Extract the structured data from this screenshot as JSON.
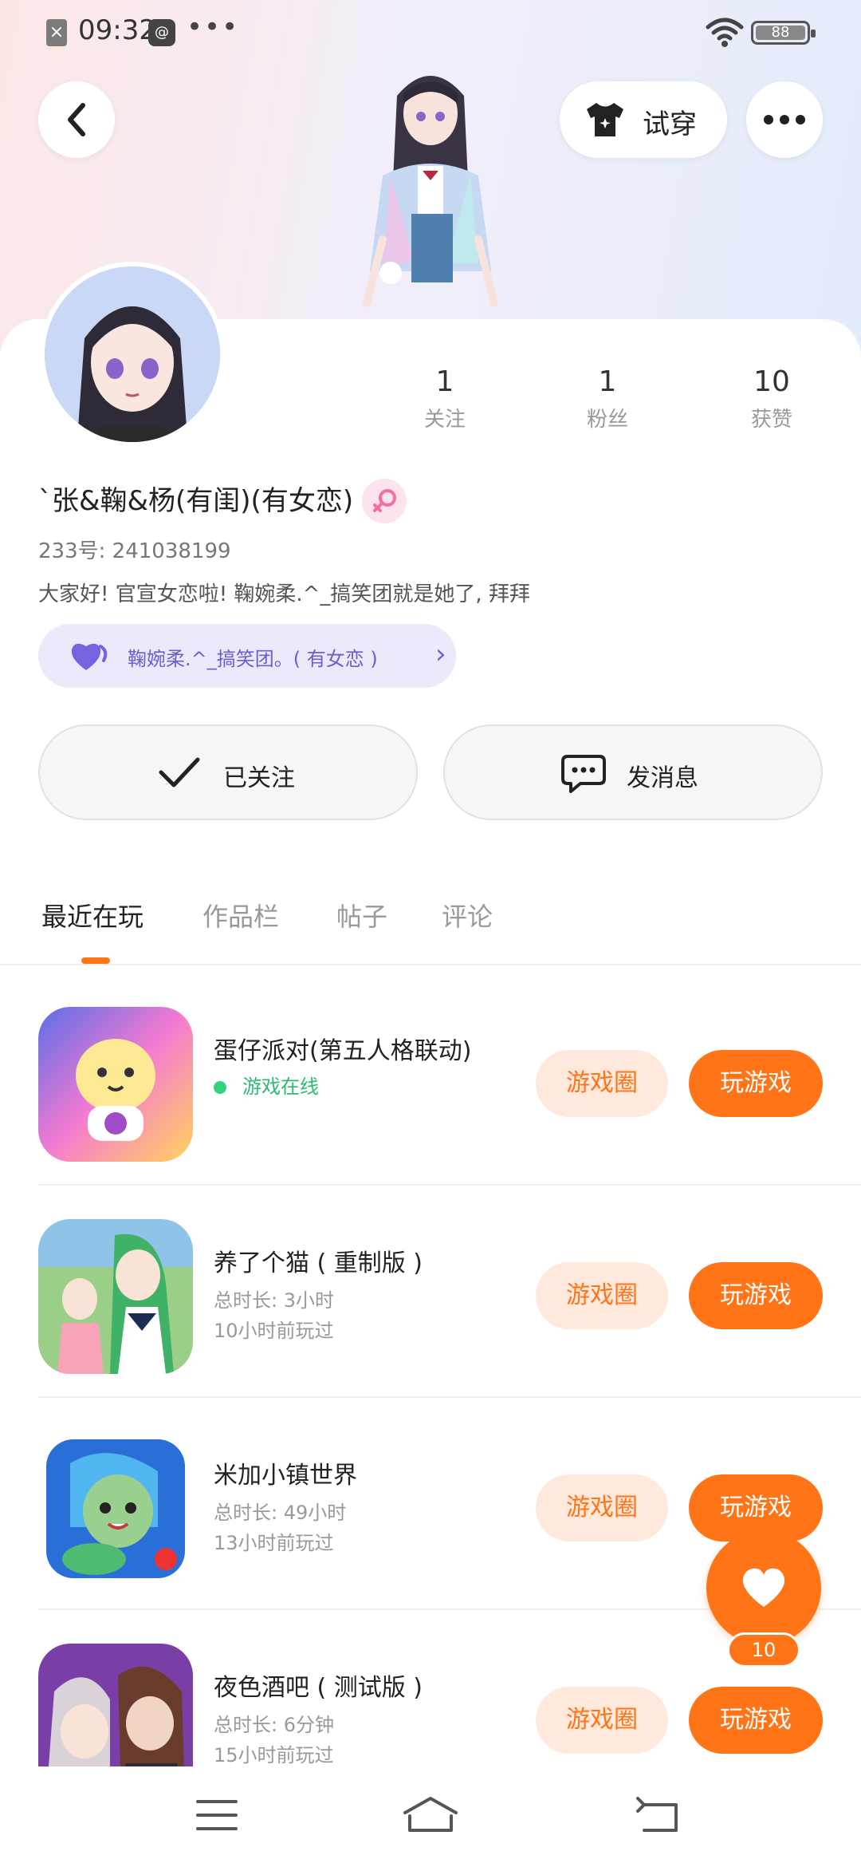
{
  "status_bar": {
    "time": "09:32",
    "battery": "88",
    "dots": "•••"
  },
  "header": {
    "try_on_label": "试穿"
  },
  "profile": {
    "name": "`张&鞠&杨(有闺)(有女恋)",
    "uid": "233号: 241038199",
    "bio": "大家好! 官宣女恋啦! 鞠婉柔.^_搞笑团就是她了, 拜拜",
    "group_chip": "鞠婉柔.^_搞笑团。( 有女恋 )",
    "stats": [
      {
        "value": "1",
        "label": "关注"
      },
      {
        "value": "1",
        "label": "粉丝"
      },
      {
        "value": "10",
        "label": "获赞"
      }
    ]
  },
  "actions": {
    "follow_label": "已关注",
    "message_label": "发消息"
  },
  "tabs": [
    {
      "label": "最近在玩"
    },
    {
      "label": "作品栏"
    },
    {
      "label": "帖子"
    },
    {
      "label": "评论"
    }
  ],
  "games": [
    {
      "title": "蛋仔派对(第五人格联动)",
      "status": "游戏在线",
      "circle": "游戏圈",
      "play": "玩游戏"
    },
    {
      "title": "养了个猫 ( 重制版 )",
      "total": "总时长: 3小时",
      "last": "10小时前玩过",
      "circle": "游戏圈",
      "play": "玩游戏"
    },
    {
      "title": "米加小镇世界",
      "total": "总时长: 49小时",
      "last": "13小时前玩过",
      "circle": "游戏圈",
      "play": "玩游戏"
    },
    {
      "title": "夜色酒吧 ( 测试版 )",
      "total": "总时长: 6分钟",
      "last": "15小时前玩过",
      "circle": "游戏圈",
      "play": "玩游戏"
    }
  ],
  "like_fab": {
    "count": "10"
  },
  "colors": {
    "accent": "#ff7417",
    "accent_light": "#ffe8dc",
    "online": "#2dbb72",
    "chip_bg": "#ece9fb"
  }
}
